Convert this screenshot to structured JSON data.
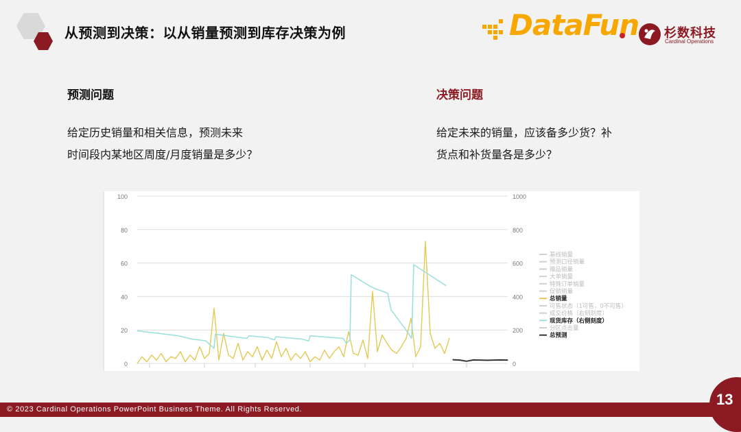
{
  "header": {
    "title": "从预测到决策：以从销量预测到库存决策为例",
    "datafun_logo_text": "DataFun",
    "shanshu_name": "杉数科技",
    "shanshu_en": "Cardinal Operations"
  },
  "prediction": {
    "heading": "预测问题",
    "lines": [
      "给定历史销量和相关信息，预测未来",
      "时间段内某地区周度/月度销量是多少？"
    ]
  },
  "decision": {
    "heading": "决策问题",
    "lines": [
      "给定未来的销量，应该备多少货？补",
      "货点和补货量各是多少？"
    ]
  },
  "footer": {
    "text": "© 2023 Cardinal Operations PowerPoint Business Theme. All Rights Reserved.",
    "page_number": "13"
  },
  "colors": {
    "accent": "#8c1a23",
    "sales": "#e3c954",
    "inventory": "#9ee0dd",
    "forecast": "#333333",
    "logo_yellow": "#f6a800"
  },
  "chart_data": {
    "type": "line",
    "left_axis": {
      "range": [
        0,
        100
      ],
      "ticks": [
        "0",
        "20",
        "40",
        "60",
        "80",
        "100"
      ]
    },
    "right_axis": {
      "range": [
        0,
        1000
      ],
      "ticks": [
        "0",
        "200",
        "400",
        "600",
        "800",
        "1000"
      ]
    },
    "grid": true,
    "legend_position": "right",
    "legend": [
      {
        "label": "基线销量",
        "active": false
      },
      {
        "label": "预测口径销量",
        "active": false
      },
      {
        "label": "赠品销量",
        "active": false
      },
      {
        "label": "大单销量",
        "active": false
      },
      {
        "label": "特殊订单销量",
        "active": false
      },
      {
        "label": "促销销量",
        "active": false
      },
      {
        "label": "总销量",
        "active": true,
        "color": "#e3c954"
      },
      {
        "label": "可售状态（1可售，0不可售）",
        "active": false
      },
      {
        "label": "成交价格（右侧刻度）",
        "active": false
      },
      {
        "label": "现货库存（右侧刻度）",
        "active": true,
        "color": "#9ee0dd"
      },
      {
        "label": "分区点击量",
        "active": false
      },
      {
        "label": "总预测",
        "active": true,
        "color": "#333333"
      }
    ],
    "series": [
      {
        "name": "总销量",
        "axis": "left",
        "x": [
          0,
          7,
          14,
          21,
          28,
          35,
          42,
          49,
          56,
          63,
          70,
          77,
          84,
          91,
          98,
          105,
          112,
          119,
          126,
          133,
          140,
          147,
          154,
          161,
          168,
          175,
          182,
          189,
          196,
          203,
          210,
          217,
          224,
          231,
          238,
          245,
          252,
          259,
          266,
          273,
          280,
          287,
          294,
          301,
          308,
          315,
          322,
          329,
          336,
          343,
          350,
          357,
          364,
          371,
          378,
          385,
          392,
          399,
          406,
          413,
          420,
          427,
          434,
          441,
          448,
          455
        ],
        "values": [
          0,
          4,
          1,
          5,
          2,
          6,
          1,
          4,
          3,
          7,
          1,
          5,
          2,
          10,
          3,
          6,
          33,
          2,
          18,
          5,
          3,
          12,
          2,
          7,
          4,
          10,
          2,
          8,
          3,
          13,
          4,
          9,
          2,
          6,
          3,
          7,
          1,
          4,
          2,
          8,
          3,
          7,
          10,
          4,
          19,
          6,
          5,
          14,
          3,
          43,
          7,
          17,
          12,
          8,
          6,
          10,
          15,
          27,
          4,
          10,
          73,
          18,
          9,
          12,
          6,
          15
        ]
      },
      {
        "name": "现货库存（右侧刻度）",
        "axis": "right",
        "x": [
          0,
          30,
          60,
          80,
          100,
          112,
          114,
          140,
          160,
          163,
          190,
          200,
          202,
          240,
          250,
          252,
          300,
          305,
          310,
          312,
          340,
          345,
          365,
          370,
          390,
          400,
          403,
          450
        ],
        "values": [
          195,
          180,
          165,
          145,
          135,
          90,
          175,
          160,
          150,
          165,
          155,
          140,
          160,
          145,
          135,
          165,
          150,
          120,
          140,
          530,
          460,
          450,
          420,
          320,
          210,
          150,
          590,
          465
        ]
      },
      {
        "name": "总预测",
        "axis": "left",
        "x": [
          460,
          470,
          480,
          490,
          500,
          510,
          520,
          530,
          540
        ],
        "values": [
          2.2,
          2.0,
          1.3,
          2.1,
          2.0,
          1.9,
          2.0,
          2.1,
          2.0
        ]
      }
    ]
  }
}
